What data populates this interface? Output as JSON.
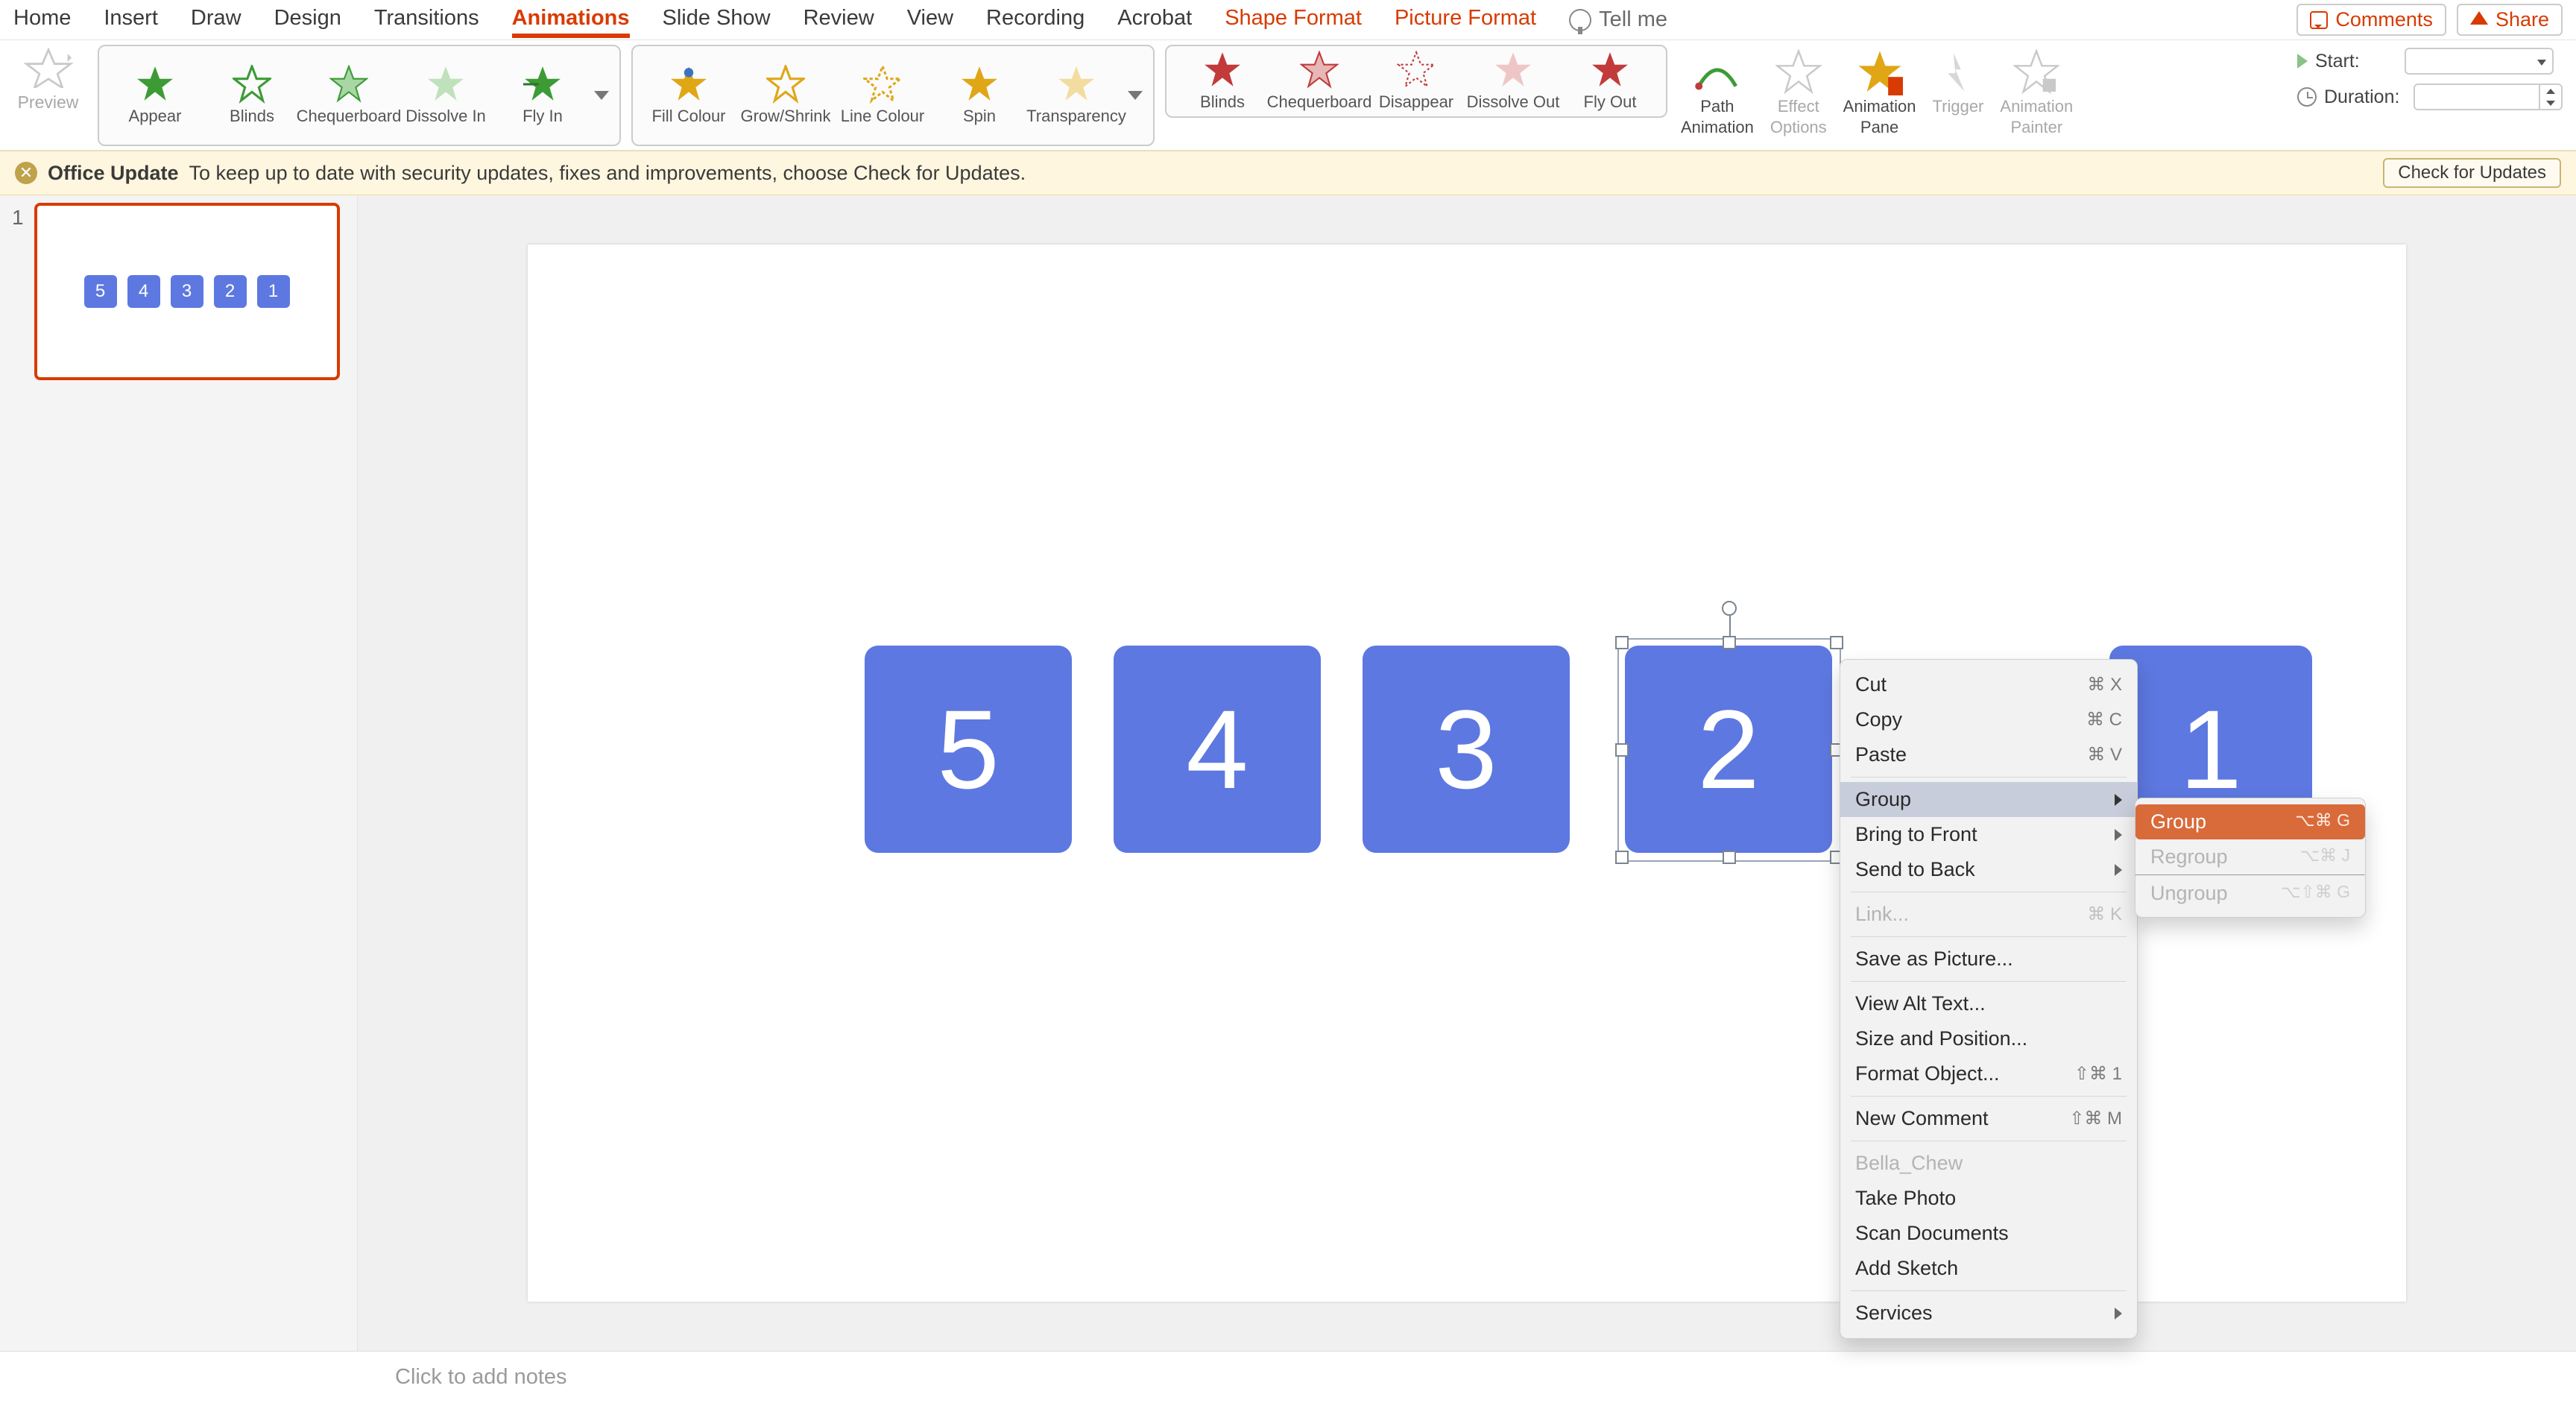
{
  "tabs": [
    "Home",
    "Insert",
    "Draw",
    "Design",
    "Transitions",
    "Animations",
    "Slide Show",
    "Review",
    "View",
    "Recording",
    "Acrobat",
    "Shape Format",
    "Picture Format"
  ],
  "tabs_active": "Animations",
  "tabs_orange": [
    "Shape Format",
    "Picture Format"
  ],
  "tell_me": "Tell me",
  "buttons": {
    "comments": "Comments",
    "share": "Share"
  },
  "ribbon": {
    "preview": "Preview",
    "entrance_items": [
      "Appear",
      "Blinds",
      "Chequerboard",
      "Dissolve In",
      "Fly In"
    ],
    "emphasis_items": [
      "Fill Colour",
      "Grow/Shrink",
      "Line Colour",
      "Spin",
      "Transparency"
    ],
    "exit_items": [
      "Blinds",
      "Chequerboard",
      "Disappear",
      "Dissolve Out",
      "Fly Out"
    ],
    "cmds": {
      "path": {
        "l1": "Path",
        "l2": "Animation"
      },
      "effect": {
        "l1": "Effect",
        "l2": "Options"
      },
      "pane": {
        "l1": "Animation",
        "l2": "Pane"
      },
      "trigger": "Trigger",
      "painter": {
        "l1": "Animation",
        "l2": "Painter"
      }
    },
    "timing": {
      "start_label": "Start:",
      "duration_label": "Duration:"
    }
  },
  "notice": {
    "title": "Office Update",
    "msg": "To keep up to date with security updates, fixes and improvements, choose Check for Updates.",
    "btn": "Check for Updates"
  },
  "thumb": {
    "num": "1",
    "vals": [
      "5",
      "4",
      "3",
      "2",
      "1"
    ]
  },
  "slide_shapes": [
    "5",
    "4",
    "3",
    "2",
    "1"
  ],
  "selected_shape_val": "2",
  "ctx": {
    "cut": "Cut",
    "cut_sc": "⌘ X",
    "copy": "Copy",
    "copy_sc": "⌘ C",
    "paste": "Paste",
    "paste_sc": "⌘ V",
    "group": "Group",
    "bring_front": "Bring to Front",
    "send_back": "Send to Back",
    "link": "Link...",
    "link_sc": "⌘ K",
    "save_pic": "Save as Picture...",
    "alt_text": "View Alt Text...",
    "size_pos": "Size and Position...",
    "format_obj": "Format Object...",
    "format_obj_sc": "⇧⌘ 1",
    "new_comment": "New Comment",
    "new_comment_sc": "⇧⌘ M",
    "user": "Bella_Chew",
    "take_photo": "Take Photo",
    "scan_docs": "Scan Documents",
    "add_sketch": "Add Sketch",
    "services": "Services"
  },
  "submenu": {
    "group": "Group",
    "group_sc": "⌥⌘ G",
    "regroup": "Regroup",
    "regroup_sc": "⌥⌘ J",
    "ungroup": "Ungroup",
    "ungroup_sc": "⌥⇧⌘ G"
  },
  "notes_placeholder": "Click to add notes",
  "colors": {
    "accent_orange": "#d83b01",
    "shape_blue": "#5d78e0",
    "submenu_highlight": "#d96a3a",
    "star_green": "#3c9b35",
    "star_yellow": "#e0a616",
    "star_red": "#c23a3a"
  }
}
